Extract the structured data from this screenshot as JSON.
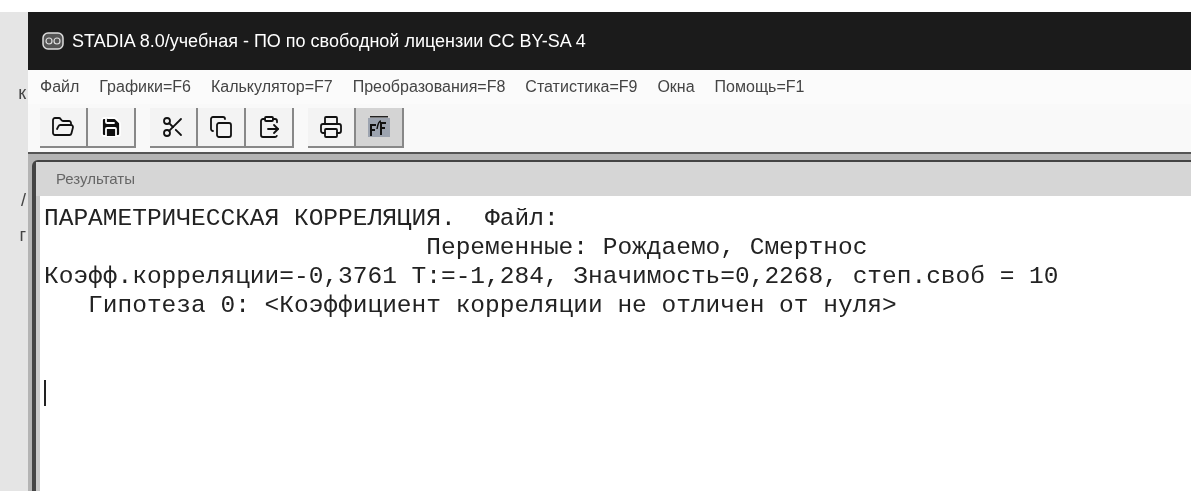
{
  "background_window": {
    "fragments": [
      "к",
      "/",
      "г"
    ]
  },
  "window": {
    "title": "STADIA 8.0/учебная - ПО по свободной лицензии CC BY-SA 4"
  },
  "menu": [
    "Файл",
    "Графики=F6",
    "Калькулятор=F7",
    "Преобразования=F8",
    "Статистика=F9",
    "Окна",
    "Помощь=F1"
  ],
  "toolbar": [
    [
      {
        "kind": "open"
      },
      {
        "kind": "save"
      }
    ],
    [
      {
        "kind": "cut"
      },
      {
        "kind": "copy"
      },
      {
        "kind": "paste"
      }
    ],
    [
      {
        "kind": "print"
      },
      {
        "kind": "fonts",
        "selected": true
      }
    ]
  ],
  "results_window": {
    "title": "Результаты",
    "lines": [
      "ПАРАМЕТРИЧЕССКАЯ КОРРЕЛЯЦИЯ.  Файл:",
      "                          Переменные: Рождаемо, Смертнос",
      "Коэфф.корреляции=-0,3761 T:=-1,284, Значимость=0,2268, степ.своб = 10",
      "   Гипотеза 0: <Коэффициент корреляции не отличен от нуля>"
    ]
  }
}
